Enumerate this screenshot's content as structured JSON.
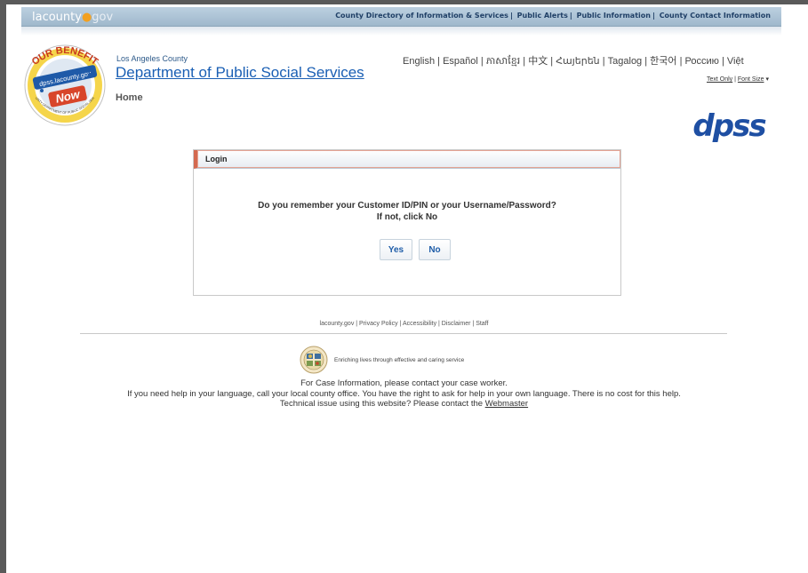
{
  "topbar": {
    "logo_main": "lacounty",
    "logo_gov": "gov",
    "nav": [
      "County Directory of Information & Services",
      "Public Alerts",
      "Public Information",
      "County Contact Information"
    ]
  },
  "seal": {
    "line1": "YOUR BENEFITS",
    "line2": "dpss.lacounty.gov",
    "line3": "Now",
    "ring": "LA COUNTY DEPARTMENT OF PUBLIC SOCIAL SERVICES"
  },
  "header": {
    "county": "Los Angeles County",
    "department": "Department of Public Social Services",
    "home": "Home",
    "languages": [
      "English",
      "Español",
      "ភាសាខ្មែរ",
      "中文",
      "Հայերեն",
      "Tagalog",
      "한국어",
      "Россию",
      "Việt"
    ],
    "text_only": "Text Only",
    "font_size": "Font Size",
    "font_size_caret": "▾",
    "dpss_logo": "dpss"
  },
  "login": {
    "title": "Login",
    "question_line1": "Do you remember your Customer ID/PIN or your Username/Password?",
    "question_line2": "If not, click No",
    "yes_label": "Yes",
    "no_label": "No"
  },
  "footer": {
    "links": [
      "lacounty.gov",
      "Privacy Policy",
      "Accessibility",
      "Disclaimer",
      "Staff"
    ],
    "tagline": "Enriching lives through effective and caring service",
    "case_line": "For Case Information, please contact your case worker.",
    "language_line": "If you need help in your language, call your local county office. You have the right to ask for help in your own language. There is no cost for this help.",
    "technical_line": "Technical issue using this website? Please contact the",
    "webmaster": "Webmaster"
  },
  "colors": {
    "link_blue": "#1a5fb4",
    "header_accent": "#d46a50",
    "topbar_text": "#1f3f66",
    "dpss_blue": "#1e4fa3"
  },
  "icons": {
    "seal": "your-benefits-now-seal-icon",
    "footer_seal": "la-county-seal-icon",
    "font_caret": "caret-down-icon"
  }
}
